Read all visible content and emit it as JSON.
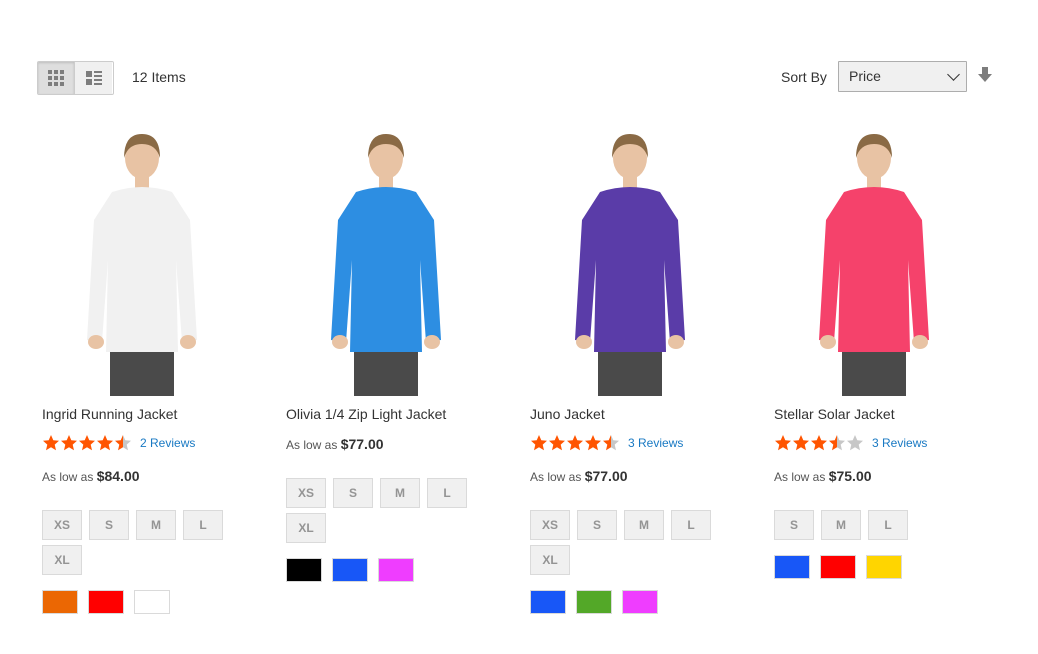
{
  "toolbar": {
    "items_count": "12",
    "items_label": "Items",
    "sort_label": "Sort By",
    "sort_value": "Price",
    "view_modes": [
      "grid",
      "list"
    ]
  },
  "products": [
    {
      "name": "Ingrid Running Jacket",
      "rating": 4.5,
      "reviews": "2 Reviews",
      "price_prefix": "As low as",
      "price": "$84.00",
      "sizes": [
        "XS",
        "S",
        "M",
        "L",
        "XL"
      ],
      "colors": [
        "#eb6703",
        "#ff0000",
        "#ffffff"
      ],
      "garment_color": "#f1f1f1"
    },
    {
      "name": "Olivia 1/4 Zip Light Jacket",
      "rating": null,
      "reviews": "",
      "price_prefix": "As low as",
      "price": "$77.00",
      "sizes": [
        "XS",
        "S",
        "M",
        "L",
        "XL"
      ],
      "colors": [
        "#000000",
        "#1857f7",
        "#ef3dff"
      ],
      "garment_color": "#2d8ee2"
    },
    {
      "name": "Juno Jacket",
      "rating": 4.5,
      "reviews": "3 Reviews",
      "price_prefix": "As low as",
      "price": "$77.00",
      "sizes": [
        "XS",
        "S",
        "M",
        "L",
        "XL"
      ],
      "colors": [
        "#1857f7",
        "#53a828",
        "#ef3dff"
      ],
      "garment_color": "#5a3ca8"
    },
    {
      "name": "Stellar Solar Jacket",
      "rating": 3.5,
      "reviews": "3 Reviews",
      "price_prefix": "As low as",
      "price": "$75.00",
      "sizes": [
        "S",
        "M",
        "L"
      ],
      "colors": [
        "#1857f7",
        "#ff0000",
        "#ffd500"
      ],
      "garment_color": "#f5426b"
    }
  ],
  "colors": {
    "star": "#ff5501",
    "star_empty": "#c7c7c7",
    "link": "#1979c3"
  }
}
